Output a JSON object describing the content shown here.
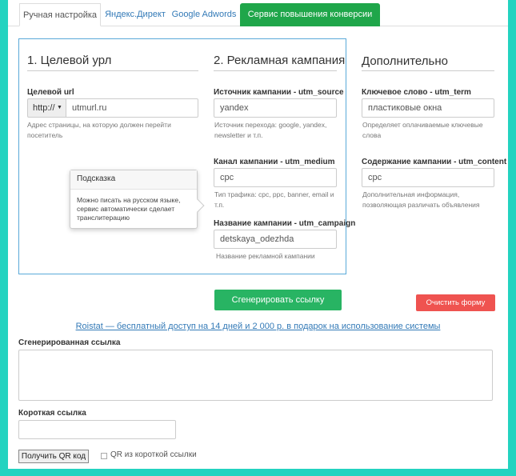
{
  "tabs": [
    {
      "label": "Ручная настройка"
    },
    {
      "label": "Яндекс.Директ"
    },
    {
      "label": "Google Adwords"
    },
    {
      "label": "Сервис повышения конверсии сайта"
    }
  ],
  "colors": {
    "accent_green": "#1fa64a",
    "generate_green": "#28b463",
    "clear_red": "#ef5350",
    "panel_border": "#5aa9d8"
  },
  "section1": {
    "title": "1. Целевой урл",
    "url_label": "Целевой url",
    "protocol_value": "http://",
    "url_value": "utmurl.ru",
    "url_help": "Адрес страницы, на которую должен перейти посетитель"
  },
  "section2": {
    "title": "2. Рекламная кампания",
    "source_label": "Источник кампании - utm_source",
    "source_value": "yandex",
    "source_help": "Источник перехода: google, yandex, newsletter и т.п.",
    "medium_label": "Канал кампании - utm_medium",
    "medium_value": "cpc",
    "medium_help": "Тип трафика: cpc, ppc, banner, email и т.п.",
    "campaign_label": "Название кампании - utm_campaign",
    "campaign_value": "detskaya_odezhda",
    "campaign_help": "Название рекламной кампании"
  },
  "section3": {
    "title": "Дополнительно",
    "term_label": "Ключевое слово - utm_term",
    "term_value": "пластиковые окна",
    "term_help": "Определяет оплачиваемые ключевые слова",
    "content_label": "Содержание кампании - utm_content",
    "content_value": "cpc",
    "content_help": "Дополнительная информация, позволяющая различать объявления"
  },
  "tooltip": {
    "title": "Подсказка",
    "text": "Можно писать на русском языке, сервис автоматически сделает транслитерацию"
  },
  "buttons": {
    "generate": "Сгенерировать ссылку",
    "clear": "Очистить форму",
    "qr": "Получить QR код"
  },
  "promo_link": "Roistat — бесплатный доступ на 14 дней и 2 000 р. в подарок на использование системы",
  "result": {
    "generated_label": "Сгенерированная ссылка",
    "short_label": "Короткая ссылка",
    "qr_checkbox_label": "QR из короткой ссылки"
  },
  "icons": {
    "dropdown": "▼"
  }
}
